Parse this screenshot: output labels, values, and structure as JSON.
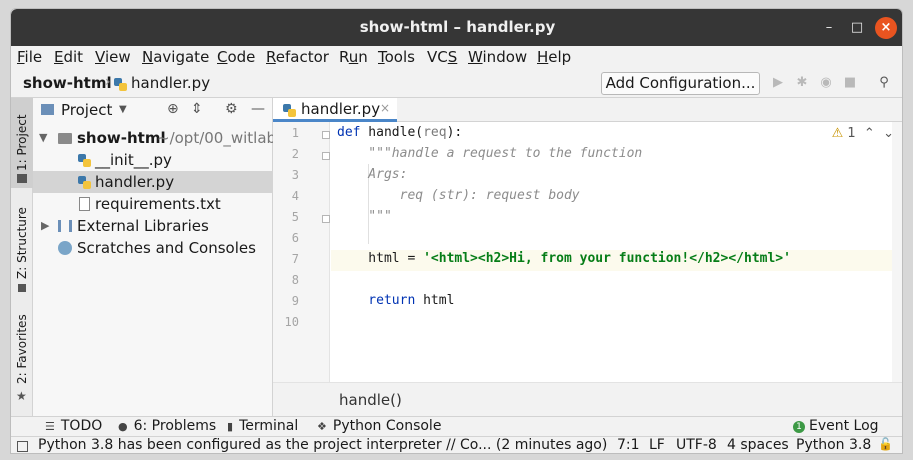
{
  "window": {
    "title": "show-html – handler.py"
  },
  "menu": [
    {
      "label": "File",
      "u": "F",
      "rest": "ile"
    },
    {
      "label": "Edit",
      "u": "E",
      "rest": "dit"
    },
    {
      "label": "View",
      "u": "V",
      "rest": "iew"
    },
    {
      "label": "Navigate",
      "u": "N",
      "rest": "avigate"
    },
    {
      "label": "Code",
      "u": "C",
      "rest": "ode"
    },
    {
      "label": "Refactor",
      "u": "R",
      "rest": "efactor"
    },
    {
      "label": "Run",
      "u": "R",
      "rest": "un",
      "pre": ""
    },
    {
      "label": "Tools",
      "u": "T",
      "rest": "ools"
    },
    {
      "label": "VCS",
      "u": "",
      "rest": "VCS"
    },
    {
      "label": "Window",
      "u": "W",
      "rest": "indow"
    },
    {
      "label": "Help",
      "u": "H",
      "rest": "elp"
    }
  ],
  "navbar": {
    "project": "show-html",
    "file": "handler.py",
    "add_configuration": "Add Configuration..."
  },
  "side_tabs": {
    "project": "1: Project",
    "structure": "Z: Structure",
    "favorites": "2: Favorites"
  },
  "project_panel": {
    "title": "Project",
    "root_name": "show-html",
    "root_path": "~/opt/00_witlab_",
    "files": [
      "__init__.py",
      "handler.py",
      "requirements.txt"
    ],
    "external_libraries": "External Libraries",
    "scratches": "Scratches and Consoles"
  },
  "editor": {
    "tab_name": "handler.py",
    "inspection_count": "1",
    "line_numbers": [
      "1",
      "2",
      "3",
      "4",
      "5",
      "6",
      "7",
      "8",
      "9",
      "10"
    ],
    "code": {
      "l1_kw": "def",
      "l1_name": " handle(",
      "l1_param": "req",
      "l1_end": "):",
      "l2": "    \"\"\"handle a request to the function",
      "l3": "    Args:",
      "l4": "        req (str): request body",
      "l5": "    \"\"\"",
      "l7_var": "    html = ",
      "l7_str": "'<html><h2>Hi, from your function!</h2></html>'",
      "l9_kw": "    return",
      "l9_rest": " html"
    },
    "breadcrumb": "handle()"
  },
  "bottom_tools": {
    "todo": "TODO",
    "problems": "6: Problems",
    "terminal": "Terminal",
    "python_console": "Python Console",
    "event_log": "Event Log"
  },
  "status": {
    "message": "Python 3.8 has been configured as the project interpreter // Co... (2 minutes ago)",
    "position": "7:1",
    "line_sep": "LF",
    "encoding": "UTF-8",
    "indent": "4 spaces",
    "interpreter": "Python 3.8"
  }
}
